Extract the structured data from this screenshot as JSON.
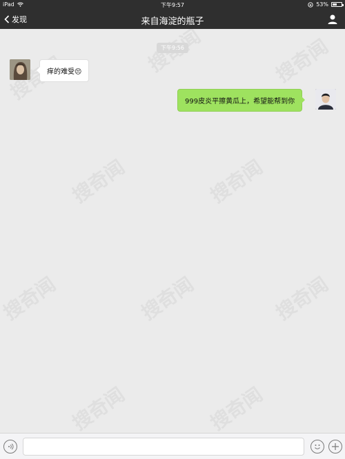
{
  "status_bar": {
    "device": "iPad",
    "time": "下午9:57",
    "battery_percent": "53%",
    "battery_level": 0.53
  },
  "nav": {
    "back_label": "发现",
    "title": "来自海淀的瓶子"
  },
  "chat": {
    "timestamp": "下午9:56",
    "messages": [
      {
        "direction": "in",
        "text": "痒的难受",
        "emoji": "😣"
      },
      {
        "direction": "out",
        "text": "999皮炎平擦黄瓜上，希望能帮到你"
      }
    ]
  },
  "watermark_text": "搜奇闻"
}
